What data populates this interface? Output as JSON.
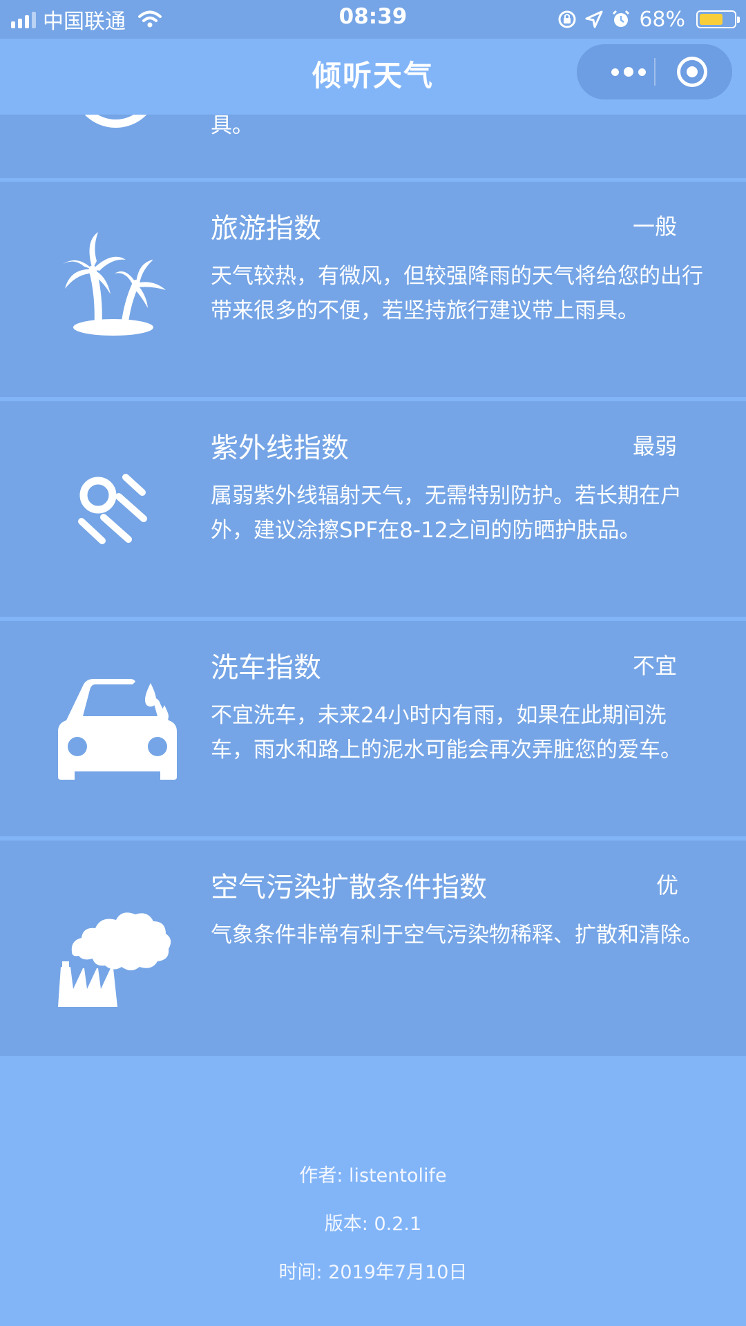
{
  "status_bar": {
    "carrier": "中国联通",
    "time": "08:39",
    "battery_percent": "68%",
    "battery_level": 0.68,
    "icons": [
      "signal-icon",
      "wifi-icon",
      "rotation-lock-icon",
      "location-icon",
      "alarm-icon",
      "battery-icon"
    ]
  },
  "nav": {
    "title": "倾听天气",
    "menu_icon": "more-dots-icon",
    "close_icon": "target-close-icon"
  },
  "colors": {
    "page_bg": "#82b5f8",
    "card_bg": "#75a5e6",
    "capsule_bg": "#6d9de2",
    "battery_fill": "#f8cf3a",
    "text": "#ffffff"
  },
  "partial_card": {
    "desc_tail": "具。",
    "icon": "weather-icon"
  },
  "cards": [
    {
      "title": "旅游指数",
      "level": "一般",
      "desc": "天气较热，有微风，但较强降雨的天气将给您的出行带来很多的不便，若坚持旅行建议带上雨具。",
      "icon": "palm-tree-icon"
    },
    {
      "title": "紫外线指数",
      "level": "最弱",
      "desc": "属弱紫外线辐射天气，无需特别防护。若长期在户外，建议涂擦SPF在8-12之间的防晒护肤品。",
      "icon": "sun-rays-icon"
    },
    {
      "title": "洗车指数",
      "level": "不宜",
      "desc": "不宜洗车，未来24小时内有雨，如果在此期间洗车，雨水和路上的泥水可能会再次弄脏您的爱车。",
      "icon": "car-wash-icon"
    },
    {
      "title": "空气污染扩散条件指数",
      "level": "优",
      "desc": "气象条件非常有利于空气污染物稀释、扩散和清除。",
      "icon": "factory-icon"
    }
  ],
  "footer": {
    "author": "作者: listentolife",
    "version": "版本: 0.2.1",
    "date": "时间: 2019年7月10日"
  }
}
